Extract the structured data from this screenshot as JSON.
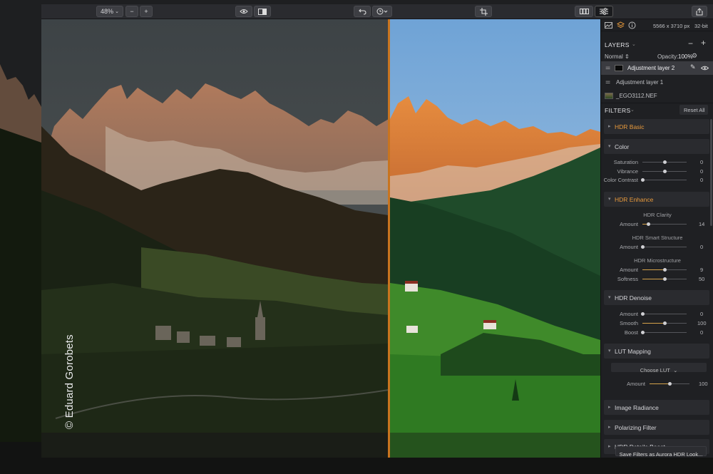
{
  "toolbar": {
    "zoom": "48%",
    "minus": "−",
    "plus": "+"
  },
  "info": {
    "dimensions": "5566 x 3710 px",
    "bitdepth": "32-bit"
  },
  "layers": {
    "title": "LAYERS",
    "blend_mode": "Normal",
    "opacity_label": "Opacity:",
    "opacity_value": "100%",
    "items": [
      {
        "label": "Adjustment layer 2"
      },
      {
        "label": "Adjustment layer 1"
      },
      {
        "label": "_EGO3112.NEF"
      }
    ]
  },
  "filters": {
    "title": "FILTERS",
    "reset": "Reset All",
    "sections": {
      "hdr_basic": "HDR Basic",
      "color": "Color",
      "hdr_enhance": "HDR Enhance",
      "hdr_denoise": "HDR Denoise",
      "lut_mapping": "LUT Mapping",
      "image_radiance": "Image Radiance",
      "polarizing": "Polarizing Filter",
      "details_boost": "HDR Details Boost"
    },
    "color": {
      "saturation": {
        "label": "Saturation",
        "value": "0",
        "level": 0.5
      },
      "vibrance": {
        "label": "Vibrance",
        "value": "0",
        "level": 0.5
      },
      "color_contrast": {
        "label": "Color Contrast",
        "value": "0",
        "level": 0
      }
    },
    "enhance": {
      "clarity_title": "HDR Clarity",
      "clarity_amount": {
        "label": "Amount",
        "value": "14",
        "level": 0.14
      },
      "smart_title": "HDR Smart Structure",
      "smart_amount": {
        "label": "Amount",
        "value": "0",
        "level": 0
      },
      "micro_title": "HDR Microstructure",
      "micro_amount": {
        "label": "Amount",
        "value": "9",
        "level": 0.5
      },
      "micro_softness": {
        "label": "Softness",
        "value": "50",
        "level": 0.5
      }
    },
    "denoise": {
      "amount": {
        "label": "Amount",
        "value": "0",
        "level": 0
      },
      "smooth": {
        "label": "Smooth",
        "value": "100",
        "level": 0.5
      },
      "boost": {
        "label": "Boost",
        "value": "0",
        "level": 0
      }
    },
    "lut": {
      "choose": "Choose LUT",
      "amount": {
        "label": "Amount",
        "value": "100",
        "level": 0.5
      }
    },
    "save_look": "Save Filters as Aurora HDR Look..."
  },
  "watermark": "© Eduard Gorobets"
}
